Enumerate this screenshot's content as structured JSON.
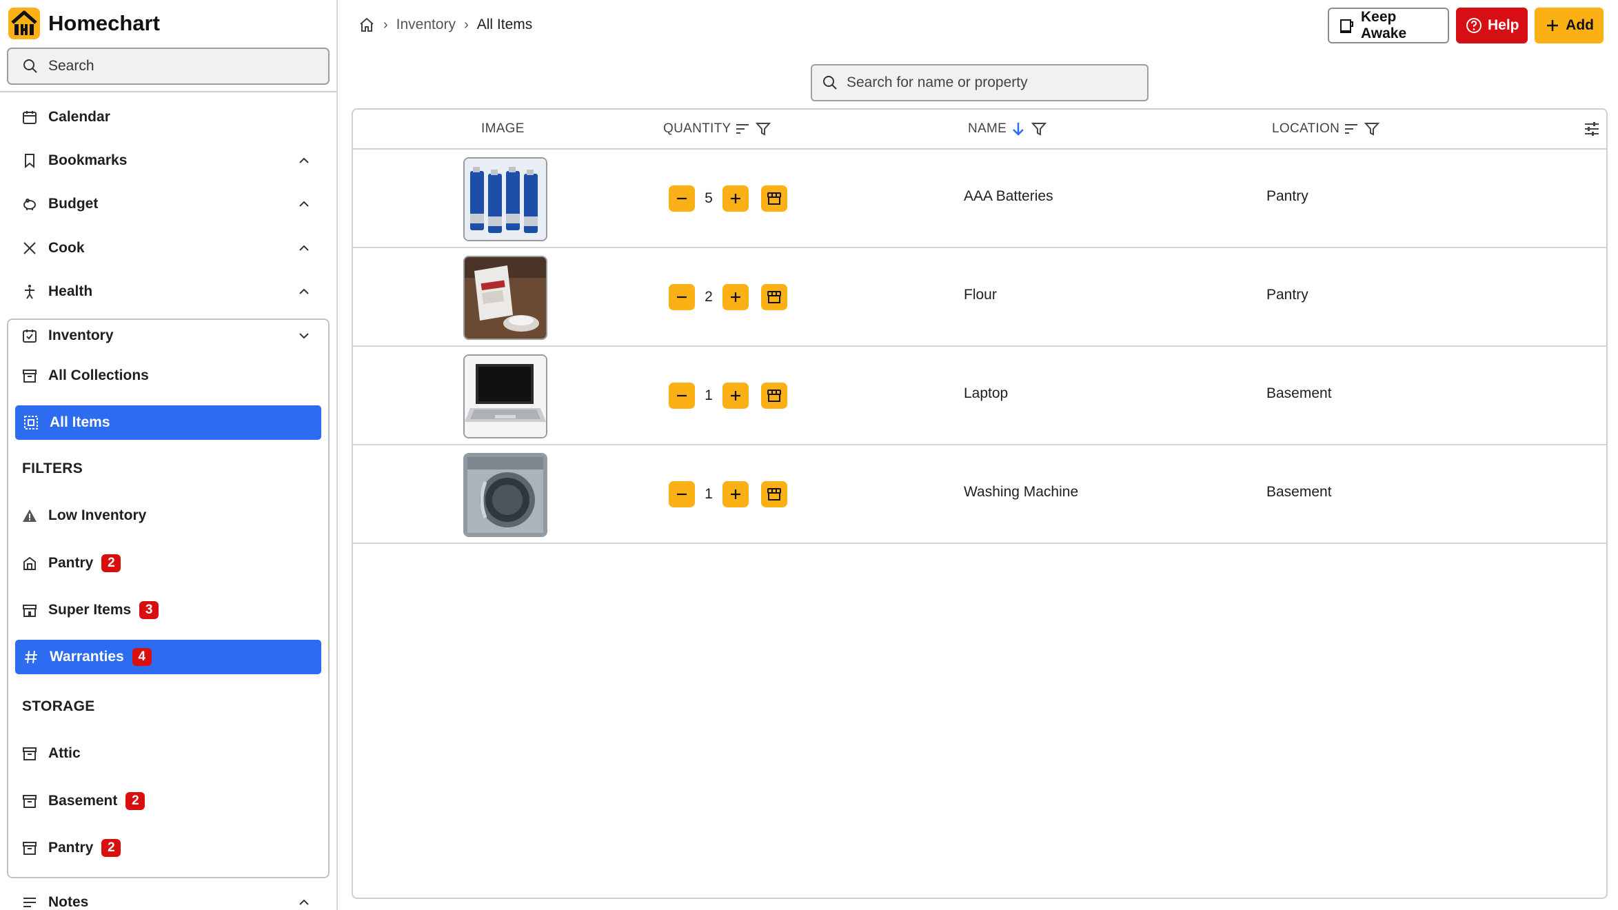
{
  "colors": {
    "accent_yellow": "#fbb015",
    "selection_blue": "#2d6cf0",
    "help_red": "#d70f14",
    "badge_red": "#d90f0f"
  },
  "app": {
    "name": "Homechart"
  },
  "sidebar": {
    "search_label": "Search",
    "nav": [
      {
        "label": "Calendar",
        "icon": "calendar-icon"
      },
      {
        "label": "Bookmarks",
        "icon": "bookmark-icon"
      },
      {
        "label": "Budget",
        "icon": "piggy-bank-icon"
      },
      {
        "label": "Cook",
        "icon": "utensils-icon"
      },
      {
        "label": "Health",
        "icon": "person-icon"
      },
      {
        "label": "Inventory",
        "icon": "inventory-icon"
      }
    ],
    "inventory": {
      "all_collections": "All Collections",
      "all_items": "All Items",
      "filters_label": "FILTERS",
      "filters": [
        {
          "label": "Low Inventory",
          "badge": ""
        },
        {
          "label": "Pantry",
          "badge": "2"
        },
        {
          "label": "Super Items",
          "badge": "3"
        },
        {
          "label": "Warranties",
          "badge": "4"
        }
      ],
      "storage_label": "STORAGE",
      "storage": [
        {
          "label": "Attic",
          "badge": ""
        },
        {
          "label": "Basement",
          "badge": "2"
        },
        {
          "label": "Pantry",
          "badge": "2"
        }
      ]
    },
    "notes": {
      "label": "Notes"
    }
  },
  "header": {
    "breadcrumb": {
      "parent": "Inventory",
      "current": "All Items"
    },
    "buttons": {
      "keep_awake": "Keep Awake",
      "help": "Help",
      "add": "Add"
    }
  },
  "search": {
    "placeholder": "Search for name or property"
  },
  "table": {
    "columns": {
      "image": "IMAGE",
      "quantity": "QUANTITY",
      "name": "NAME",
      "location": "LOCATION"
    },
    "rows": [
      {
        "quantity": "5",
        "name": "AAA Batteries",
        "location": "Pantry",
        "image": "batteries"
      },
      {
        "quantity": "2",
        "name": "Flour",
        "location": "Pantry",
        "image": "flour"
      },
      {
        "quantity": "1",
        "name": "Laptop",
        "location": "Basement",
        "image": "laptop"
      },
      {
        "quantity": "1",
        "name": "Washing Machine",
        "location": "Basement",
        "image": "washing-machine"
      }
    ]
  }
}
